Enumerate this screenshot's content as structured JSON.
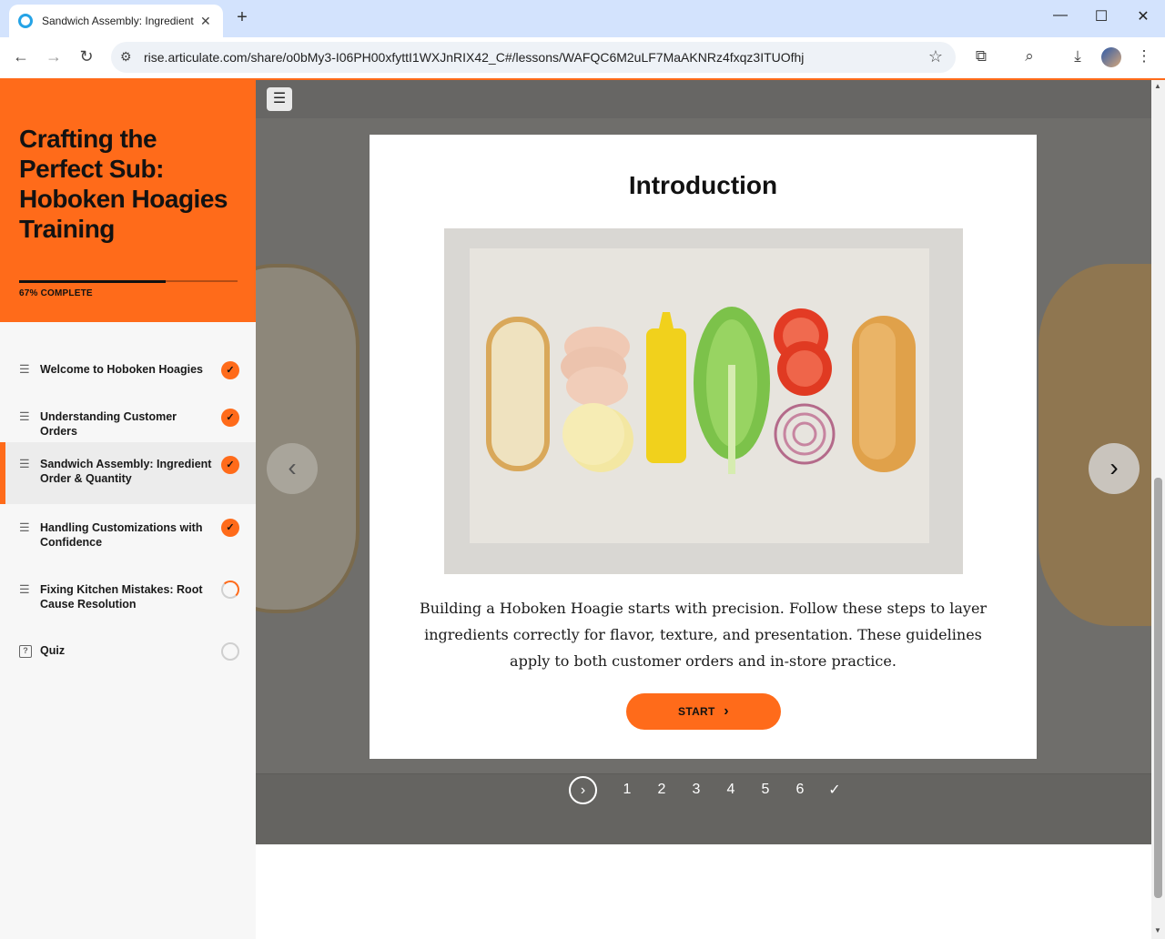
{
  "browser": {
    "tab_title": "Sandwich Assembly: Ingredient",
    "url": "rise.articulate.com/share/o0bMy3-I06PH00xfyttI1WXJnRIX42_C#/lessons/WAFQC6M2uLF7MaAKNRz4fxqz3ITUOfhj",
    "new_tab": "+",
    "close": "✕",
    "minimize": "—",
    "maximize": "☐",
    "win_close": "✕",
    "back": "←",
    "forward": "→",
    "reload": "↻",
    "star": "☆"
  },
  "sidebar": {
    "course_title": "Crafting the Perfect Sub: Hoboken Hoagies Training",
    "progress_label": "67% COMPLETE",
    "progress": 0.67,
    "lessons": [
      {
        "label": "Welcome to Hoboken Hoagies",
        "status": "complete"
      },
      {
        "label": "Understanding Customer Orders",
        "status": "complete"
      },
      {
        "label": "Sandwich Assembly: Ingredient Order & Quantity",
        "status": "complete"
      },
      {
        "label": "Handling Customizations with Confidence",
        "status": "complete"
      },
      {
        "label": "Fixing Kitchen Mistakes: Root Cause Resolution",
        "status": "in-progress"
      },
      {
        "label": "Quiz",
        "status": "not-started"
      }
    ]
  },
  "main": {
    "menu_icon": "☰",
    "card_title": "Introduction",
    "body": "Building a Hoboken Hoagie starts with precision. Follow these steps to layer ingredients correctly for flavor, texture, and presentation. These guidelines apply to both customer orders and in-store practice.",
    "start_label": "START",
    "start_chevron": "›",
    "prev_arrow": "‹",
    "next_arrow": "›",
    "pager": {
      "next": "›",
      "pages": [
        "1",
        "2",
        "3",
        "4",
        "5",
        "6",
        "✓"
      ]
    }
  },
  "colors": {
    "accent": "#ff6b1a",
    "stage": "#6f6e6b"
  }
}
